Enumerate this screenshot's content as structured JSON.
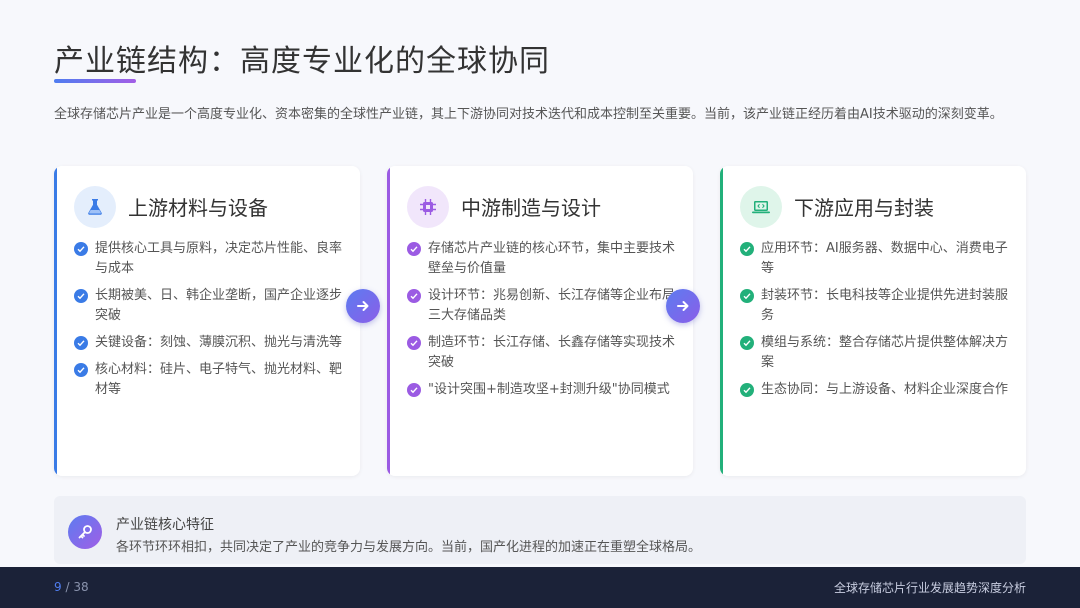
{
  "header": {
    "title": "产业链结构：高度专业化的全球协同"
  },
  "intro": "全球存储芯片产业是一个高度专业化、资本密集的全球性产业链，其上下游协同对技术迭代和成本控制至关重要。当前，该产业链正经历着由AI技术驱动的深刻变革。",
  "cards": [
    {
      "title": "上游材料与设备",
      "icon": "flask-icon",
      "accent": "#3a7be6",
      "items": [
        "提供核心工具与原料，决定芯片性能、良率与成本",
        "长期被美、日、韩企业垄断，国产企业逐步突破",
        "关键设备：刻蚀、薄膜沉积、抛光与清洗等",
        "核心材料：硅片、电子特气、抛光材料、靶材等"
      ]
    },
    {
      "title": "中游制造与设计",
      "icon": "chip-icon",
      "accent": "#9b5be3",
      "items": [
        "存储芯片产业链的核心环节，集中主要技术壁垒与价值量",
        "设计环节：兆易创新、长江存储等企业布局三大存储品类",
        "制造环节：长江存储、长鑫存储等实现技术突破",
        "\"设计突围+制造攻坚+封测升级\"协同模式"
      ]
    },
    {
      "title": "下游应用与封装",
      "icon": "laptop-code-icon",
      "accent": "#22b07a",
      "items": [
        "应用环节：AI服务器、数据中心、消费电子等",
        "封装环节：长电科技等企业提供先进封装服务",
        "模组与系统：整合存储芯片提供整体解决方案",
        "生态协同：与上游设备、材料企业深度合作"
      ]
    }
  ],
  "summary": {
    "icon": "key-icon",
    "title": "产业链核心特征",
    "text": "各环节环环相扣，共同决定了产业的竞争力与发展方向。当前，国产化进程的加速正在重塑全球格局。"
  },
  "footer": {
    "page_current": "9",
    "page_separator": " / ",
    "page_total": "38",
    "title": "全球存储芯片行业发展趋势深度分析"
  }
}
